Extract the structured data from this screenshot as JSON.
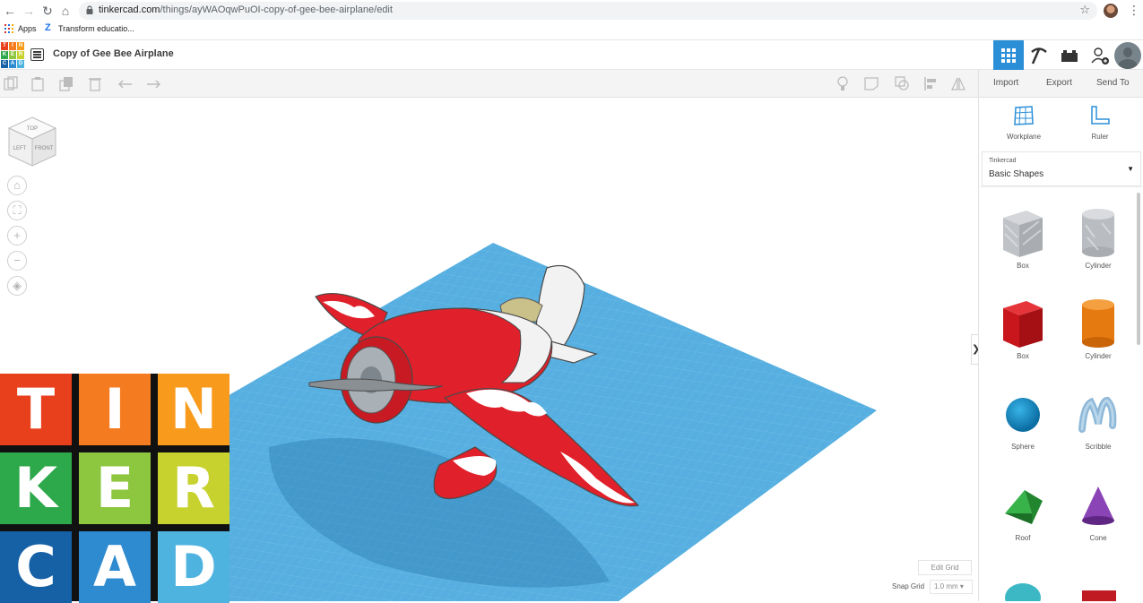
{
  "browser": {
    "url_host": "tinkercad.com",
    "url_path": "/things/ayWAOqwPuOI-copy-of-gee-bee-airplane/edit",
    "bookmarks": [
      {
        "label": "Apps",
        "icon": "apps-grid-icon"
      },
      {
        "label": "Transform educatio...",
        "icon": "z-icon"
      }
    ]
  },
  "header": {
    "logo_letters": [
      "T",
      "I",
      "N",
      "K",
      "E",
      "R",
      "C",
      "A",
      "D"
    ],
    "title": "Copy of Gee Bee Airplane"
  },
  "toolbar": {
    "io_tabs": [
      "Import",
      "Export",
      "Send To"
    ]
  },
  "viewport": {
    "viewcube": {
      "top": "TOP",
      "left": "LEFT",
      "front": "FRONT"
    },
    "edit_grid": "Edit Grid",
    "snap_grid_label": "Snap Grid",
    "snap_grid_value": "1.0 mm ▾"
  },
  "big_logo": {
    "letters": [
      "T",
      "I",
      "N",
      "K",
      "E",
      "R",
      "C",
      "A",
      "D"
    ],
    "colors": [
      "#e8401c",
      "#f47b20",
      "#f89b1c",
      "#2da84a",
      "#8dc63f",
      "#c7d22e",
      "#1660a5",
      "#2f8bd0",
      "#4fb3e0"
    ]
  },
  "right_panel": {
    "tools": [
      {
        "label": "Workplane"
      },
      {
        "label": "Ruler"
      }
    ],
    "library_small": "Tinkercad",
    "library_name": "Basic Shapes",
    "shapes": [
      {
        "label": "Box",
        "color": "#b9bcc0"
      },
      {
        "label": "Cylinder",
        "color": "#b9bcc0"
      },
      {
        "label": "Box",
        "color": "#d4181e"
      },
      {
        "label": "Cylinder",
        "color": "#f08a16"
      },
      {
        "label": "Sphere",
        "color": "#1990c8"
      },
      {
        "label": "Scribble",
        "color": "#8eb8d8"
      },
      {
        "label": "Roof",
        "color": "#2e9a3a"
      },
      {
        "label": "Cone",
        "color": "#7b3aa0"
      }
    ]
  },
  "colors": {
    "accent": "#2b8fd8",
    "workplane": "#4aa6dc",
    "plane_red": "#e0202a"
  }
}
